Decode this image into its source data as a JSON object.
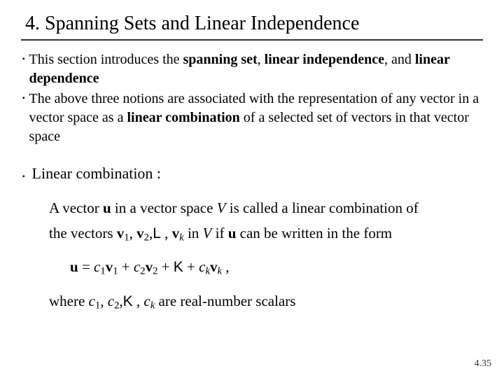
{
  "title": "4. Spanning Sets and Linear Independence",
  "bullets": [
    {
      "pre": "This section introduces the ",
      "em1": "spanning set",
      "mid1": ", ",
      "em2": "linear independence",
      "mid2": ", and ",
      "em3": "linear dependence",
      "post": ""
    },
    {
      "pre": "The above three notions are associated with the representation of any vector in a vector space as a ",
      "em1": "linear combination",
      "mid1": " of a selected set of vectors in that vector space",
      "em2": "",
      "mid2": "",
      "em3": "",
      "post": ""
    }
  ],
  "lc_heading": "Linear combination :",
  "def": {
    "l1a": "A vector ",
    "l1u": "u",
    "l1b": " in a vector space ",
    "l1V": "V",
    "l1c": " is called a linear combination of",
    "l2a": "the vectors ",
    "l2v1": "v",
    "l2s1": "1",
    "l2comma1": ", ",
    "l2v2": "v",
    "l2s2": "2",
    "l2comma2": ",",
    "l2L": "L",
    "l2comma3": " , ",
    "l2vk": "v",
    "l2sk": "k",
    "l2b": " in ",
    "l2V": "V",
    "l2c": " if ",
    "l2u": "u",
    "l2d": " can be written in the form"
  },
  "eq": {
    "u": "u",
    "eq": " = ",
    "c1": "c",
    "s1": "1",
    "v1": "v",
    "vs1": "1",
    "plus1": " + ",
    "c2": "c",
    "s2": "2",
    "v2": "v",
    "vs2": "2",
    "plus2": " + ",
    "K": "K",
    "plus3": "  + ",
    "ck": "c",
    "sk": "k",
    "vk": "v",
    "vsk": "k",
    "comma": " ,"
  },
  "where": {
    "a": "where ",
    "c1": "c",
    "s1": "1",
    "comma1": ", ",
    "c2": "c",
    "s2": "2",
    "comma2": ",",
    "K": "K",
    "comma3": " , ",
    "ck": "c",
    "sk": "k",
    "b": " are real-number scalars"
  },
  "pagenum": "4.35"
}
